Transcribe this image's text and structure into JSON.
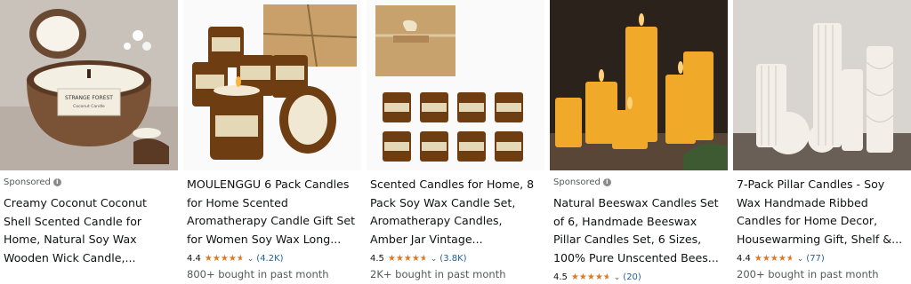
{
  "sponsored_label": "Sponsored",
  "cards": [
    {
      "title": "Creamy Coconut Coconut Shell Scented Candle for Home, Natural Soy Wax Wooden Wick Candle,...",
      "image_label_1": "STRANGE FOREST",
      "image_label_2": "Coconut Candle"
    },
    {
      "title": "MOULENGGU 6 Pack Candles for Home Scented Aromatherapy Candle Gift Set for Women Soy Wax Long...",
      "rating": "4.4",
      "review_count": "(4.2K)",
      "bought": "800+ bought in past month",
      "stars_value": 4.4
    },
    {
      "title": "Scented Candles for Home, 8 Pack Soy Wax Candle Set, Aromatherapy Candles, Amber Jar Vintage...",
      "rating": "4.5",
      "review_count": "(3.8K)",
      "bought": "2K+ bought in past month",
      "stars_value": 4.5
    },
    {
      "title": "Natural Beeswax Candles Set of 6, Handmade Beeswax Pillar Candles Set, 6 Sizes, 100% Pure Unscented Bees...",
      "rating": "4.5",
      "review_count": "(20)",
      "stars_value": 4.5
    },
    {
      "title": "7-Pack Pillar Candles - Soy Wax Handmade Ribbed Candles for Home Decor, Housewarming Gift, Shelf &...",
      "rating": "4.4",
      "review_count": "(77)",
      "bought": "200+ bought in past month",
      "stars_value": 4.4
    }
  ],
  "colors": {
    "star": "#de7921",
    "link": "#2162a1",
    "muted": "#565959"
  }
}
